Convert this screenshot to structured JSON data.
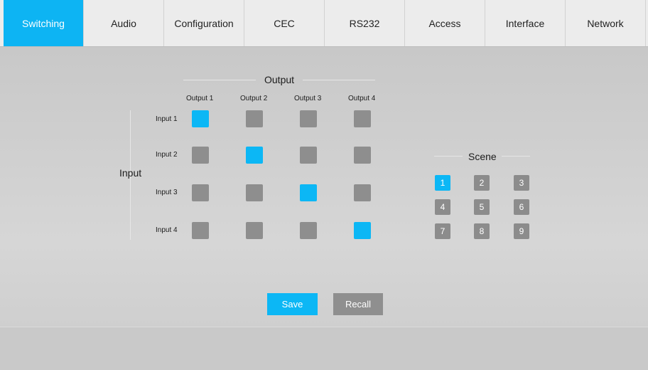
{
  "tabs": [
    {
      "label": "Switching",
      "active": true
    },
    {
      "label": "Audio",
      "active": false
    },
    {
      "label": "Configuration",
      "active": false
    },
    {
      "label": "CEC",
      "active": false
    },
    {
      "label": "RS232",
      "active": false
    },
    {
      "label": "Access",
      "active": false
    },
    {
      "label": "Interface",
      "active": false
    },
    {
      "label": "Network",
      "active": false
    }
  ],
  "matrix": {
    "output_title": "Output",
    "input_title": "Input",
    "outputs": [
      "Output 1",
      "Output 2",
      "Output 3",
      "Output 4"
    ],
    "inputs": [
      "Input 1",
      "Input 2",
      "Input 3",
      "Input 4"
    ],
    "selected": [
      [
        1,
        0,
        0,
        0
      ],
      [
        0,
        1,
        0,
        0
      ],
      [
        0,
        0,
        1,
        0
      ],
      [
        0,
        0,
        0,
        1
      ]
    ]
  },
  "scene": {
    "title": "Scene",
    "buttons": [
      "1",
      "2",
      "3",
      "4",
      "5",
      "6",
      "7",
      "8",
      "9"
    ],
    "active": "1"
  },
  "actions": {
    "save": "Save",
    "recall": "Recall"
  },
  "colors": {
    "accent": "#0cb7f5",
    "inactive": "#8e8e8e"
  }
}
